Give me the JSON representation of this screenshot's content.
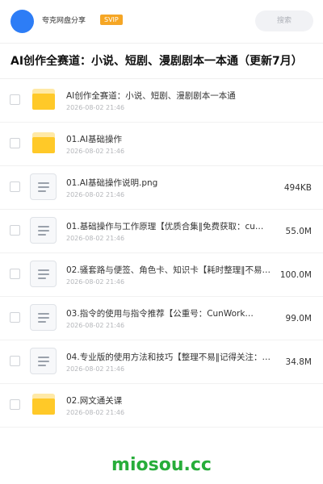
{
  "header": {
    "user_name": "夸克网盘分享",
    "badge": "SVIP",
    "search_placeholder": "搜索"
  },
  "page_title": "AI创作全赛道：小说、短剧、漫剧剧本一本通（更新7月）",
  "files": [
    {
      "type": "folder",
      "name": "AI创作全赛道：小说、短剧、漫剧剧本一本通",
      "date": "2026-08-02 21:46",
      "size": ""
    },
    {
      "type": "folder",
      "name": "01.AI基础操作",
      "date": "2026-08-02 21:46",
      "size": ""
    },
    {
      "type": "doc",
      "name": "01.AI基础操作说明.png",
      "date": "2026-08-02 21:46",
      "size": "494KB"
    },
    {
      "type": "doc",
      "name": "01.基础操作与工作原理【优质合集‖免费获取：cu…",
      "date": "2026-08-02 21:46",
      "size": "55.0M"
    },
    {
      "type": "doc",
      "name": "02.骚套路与便签、角色卡、知识卡【耗时整理‖不易…",
      "date": "2026-08-02 21:46",
      "size": "100.0M"
    },
    {
      "type": "doc",
      "name": "03.指令的使用与指令推荐【公重号：CunWork…",
      "date": "2026-08-02 21:46",
      "size": "99.0M"
    },
    {
      "type": "doc",
      "name": "04.专业版的使用方法和技巧【整理不易‖记得关注：…",
      "date": "2026-08-02 21:46",
      "size": "34.8M"
    },
    {
      "type": "folder",
      "name": "02.网文通关课",
      "date": "2026-08-02 21:46",
      "size": ""
    }
  ],
  "watermark": "miosou.cc",
  "colors": {
    "avatar": "#2d7df6",
    "svip": "#f6a623",
    "folder": "#ffc928",
    "watermark": "#27ad3a"
  }
}
